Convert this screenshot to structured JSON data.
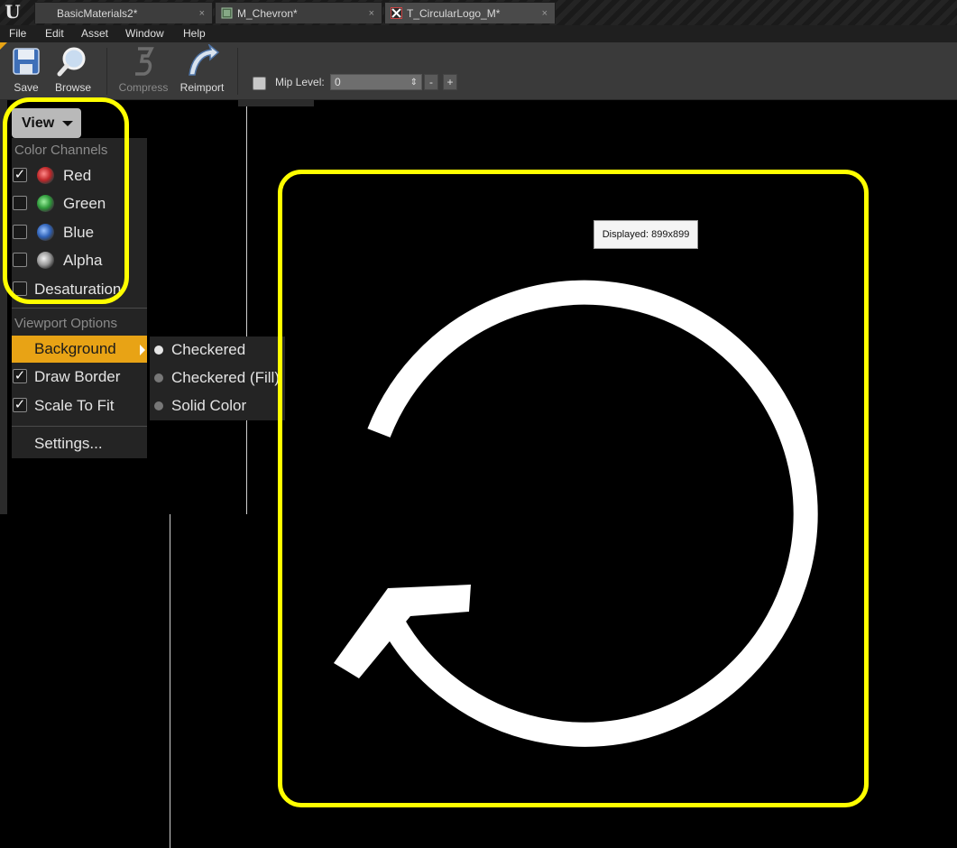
{
  "tabs": [
    {
      "label": "BasicMaterials2*",
      "close": "×",
      "active": false
    },
    {
      "label": "M_Chevron*",
      "close": "×",
      "active": false
    },
    {
      "label": "T_CircularLogo_M*",
      "close": "×",
      "active": true
    }
  ],
  "menubar": [
    "File",
    "Edit",
    "Asset",
    "Window",
    "Help"
  ],
  "toolbar": {
    "save_label": "Save",
    "browse_label": "Browse",
    "compress_label": "Compress",
    "reimport_label": "Reimport",
    "mip_level_label": "Mip Level:",
    "mip_level_value": "0",
    "minus": "-",
    "plus": "+"
  },
  "view_menu": {
    "button_label": "View",
    "color_channels_title": "Color Channels",
    "channels": [
      {
        "label": "Red",
        "checked": true,
        "color": "#c0282a"
      },
      {
        "label": "Green",
        "checked": false,
        "color": "#2e9a3a"
      },
      {
        "label": "Blue",
        "checked": false,
        "color": "#2f62b8"
      },
      {
        "label": "Alpha",
        "checked": false,
        "color": "#9a9a9a"
      }
    ],
    "desaturation_label": "Desaturation",
    "viewport_options_title": "Viewport Options",
    "background_label": "Background",
    "draw_border_label": "Draw Border",
    "draw_border_checked": true,
    "scale_to_fit_label": "Scale To Fit",
    "scale_to_fit_checked": true,
    "settings_label": "Settings..."
  },
  "background_submenu": [
    {
      "label": "Checkered",
      "selected": true
    },
    {
      "label": "Checkered (Fill)",
      "selected": false
    },
    {
      "label": "Solid Color",
      "selected": false
    }
  ],
  "viewport": {
    "displayed_label": "Displayed: 899x899"
  },
  "colors": {
    "accent": "#e8a315",
    "annotation": "#ffff00"
  }
}
